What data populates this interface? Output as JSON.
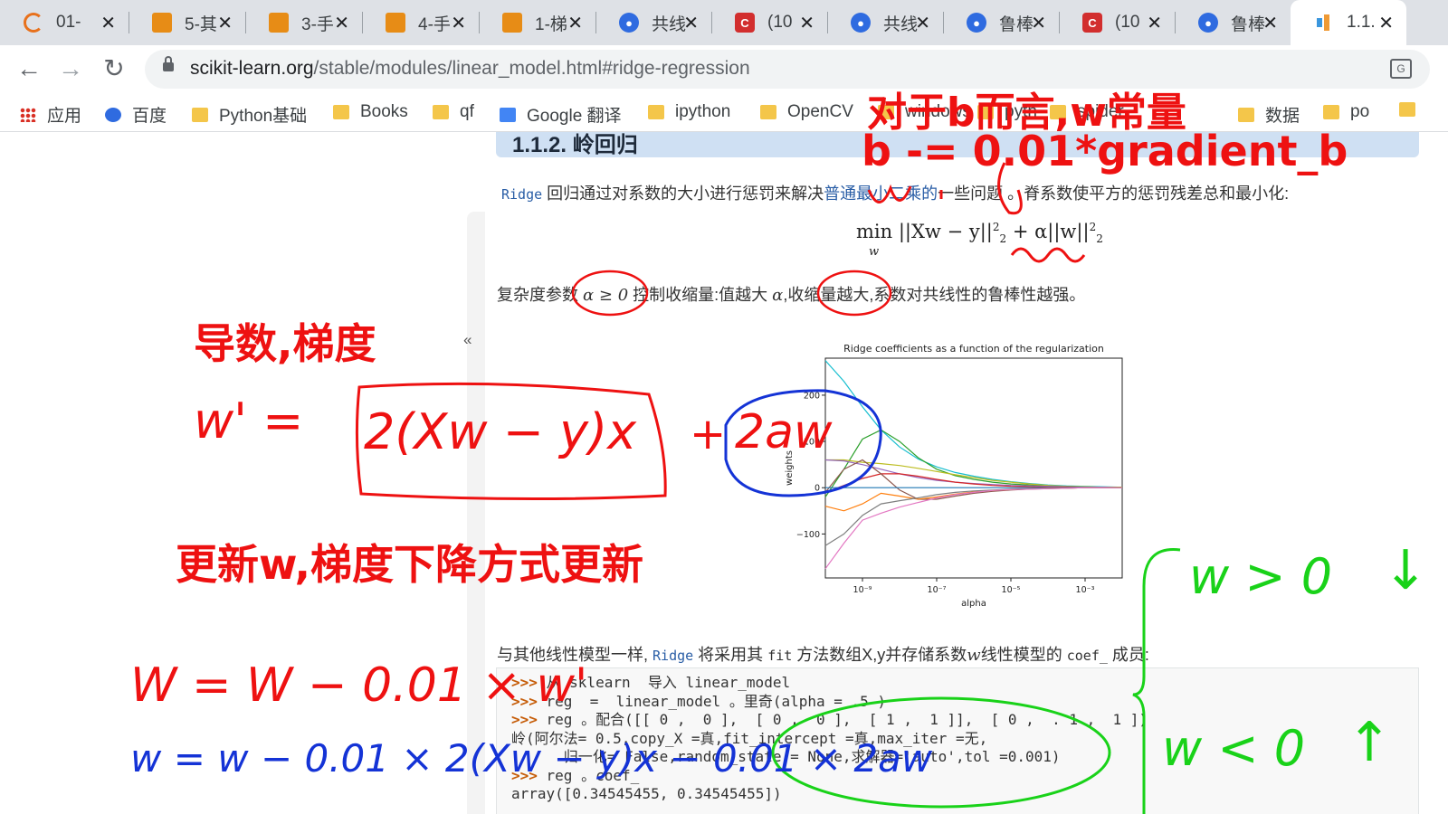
{
  "tabs": [
    {
      "title": "01-",
      "icon": "ring-icon"
    },
    {
      "title": "5-其",
      "icon": "book-icon"
    },
    {
      "title": "3-手",
      "icon": "book-icon"
    },
    {
      "title": "4-手",
      "icon": "book-icon"
    },
    {
      "title": "1-梯",
      "icon": "book-icon"
    },
    {
      "title": "共线",
      "icon": "baidu-paw-icon"
    },
    {
      "title": "(10",
      "icon": "csdn-c-icon"
    },
    {
      "title": "共线",
      "icon": "baidu-paw-icon"
    },
    {
      "title": "鲁棒",
      "icon": "baidu-paw-icon"
    },
    {
      "title": "(10",
      "icon": "csdn-c-icon"
    },
    {
      "title": "鲁棒",
      "icon": "baidu-paw-icon"
    },
    {
      "title": "1.1.",
      "icon": "sklearn-bars-icon"
    }
  ],
  "toolbar": {
    "url_host": "scikit-learn.org",
    "url_path": "/stable/modules/linear_model.html#ridge-regression"
  },
  "bookmarks": [
    {
      "label": "应用",
      "icon": "apps-grid-icon"
    },
    {
      "label": "百度",
      "icon": "baidu-paw-icon"
    },
    {
      "label": "Python基础",
      "icon": "folder-icon"
    },
    {
      "label": "Books",
      "icon": "folder-icon"
    },
    {
      "label": "qf",
      "icon": "folder-icon"
    },
    {
      "label": "Google 翻译",
      "icon": "google-translate-icon"
    },
    {
      "label": "ipython",
      "icon": "folder-icon"
    },
    {
      "label": "OpenCV",
      "icon": "folder-icon"
    },
    {
      "label": "windows",
      "icon": "folder-icon"
    },
    {
      "label": "pyth",
      "icon": "folder-icon"
    },
    {
      "label": "spider",
      "icon": "folder-icon"
    },
    {
      "label": "数据",
      "icon": "folder-icon"
    },
    {
      "label": "po",
      "icon": "folder-icon"
    }
  ],
  "doc": {
    "heading_fragment": "1.1.2. 岭回归",
    "ridge_code": "Ridge",
    "intro_before_link": " 回归通过对系数的大小进行惩罚来解决",
    "intro_link": "普通最小二乘的",
    "intro_after_link": "一些问题 。脊系数使平方的惩罚残差总和最小化:",
    "formula_main": "min ||Xw − y||",
    "formula_sub_w": "w",
    "formula_plus": " + α||w||",
    "formula_exp": "2",
    "formula_idx": "2",
    "complexity_text_1": "复杂度参数 ",
    "complexity_alpha": "α ≥ 0",
    "complexity_text_2": " 控制收缩量:值越大 ",
    "complexity_alpha2": "α",
    "complexity_text_3": ",收缩量越大,系数对共线性的鲁棒性越强。",
    "collapse_glyph": "«",
    "like_before_1": "与其他线性模型一样, ",
    "like_code_1": "Ridge",
    "like_before_2": " 将采用其 ",
    "like_code_2": "fit",
    "like_before_3": " 方法数组X,y并存储系数",
    "like_w": "w",
    "like_before_4": "线性模型的 ",
    "like_code_3": "coef_",
    "like_after": " 成员:",
    "code_lines": [
      {
        "prompt": ">>> ",
        "text": "从 sklearn  导入 linear_model"
      },
      {
        "prompt": ">>> ",
        "text": "reg  =  linear_model 。里奇(alpha = .5 )"
      },
      {
        "prompt": ">>> ",
        "text": "reg 。配合([[ 0 ,  0 ],  [ 0 ,  0 ],  [ 1 ,  1 ]],  [ 0 ,  . 1 ,  1 ])"
      },
      {
        "prompt": "",
        "text": "岭(阿尔法= 0.5,copy_X =真,fit_intercept =真,max_iter =无,"
      },
      {
        "prompt": "",
        "text": "      归一化= False,random_state = None,求解器='auto',tol =0.001)"
      },
      {
        "prompt": ">>> ",
        "text": "reg 。coef_"
      },
      {
        "prompt": "",
        "text": "array([0.34545455, 0.34545455])"
      }
    ]
  },
  "chart_data": {
    "type": "line",
    "title": "Ridge coefficients as a function of the regularization",
    "xlabel": "alpha",
    "ylabel": "weights",
    "xscale": "log",
    "x_ticks": [
      "10⁻⁹",
      "10⁻⁷",
      "10⁻⁵",
      "10⁻³"
    ],
    "x_tick_exponents": [
      -9,
      -7,
      -5,
      -3
    ],
    "y_ticks": [
      200,
      100,
      0,
      -100
    ],
    "xlim_exp": [
      -10,
      -2
    ],
    "ylim": [
      -195,
      280
    ],
    "grid": false,
    "x": [
      -10,
      -9.5,
      -9,
      -8.5,
      -8,
      -7.5,
      -7,
      -6.5,
      -6,
      -5.5,
      -5,
      -4.5,
      -4,
      -3.5,
      -3,
      -2.5,
      -2
    ],
    "series": [
      {
        "color": "#17becf",
        "values": [
          275,
          230,
          175,
          125,
          88,
          62,
          45,
          33,
          25,
          18,
          13,
          9,
          6,
          4,
          3,
          2,
          1
        ]
      },
      {
        "color": "#2ca02c",
        "values": [
          -20,
          40,
          105,
          125,
          100,
          65,
          40,
          26,
          18,
          12,
          8,
          6,
          4,
          3,
          2,
          1,
          1
        ]
      },
      {
        "color": "#bcbd22",
        "values": [
          60,
          60,
          55,
          52,
          48,
          42,
          35,
          28,
          22,
          16,
          12,
          8,
          5,
          3,
          2,
          1,
          1
        ]
      },
      {
        "color": "#9467bd",
        "values": [
          60,
          58,
          50,
          40,
          30,
          22,
          16,
          12,
          9,
          7,
          5,
          4,
          3,
          2,
          1,
          1,
          0
        ]
      },
      {
        "color": "#d62728",
        "values": [
          -10,
          5,
          20,
          30,
          30,
          25,
          18,
          12,
          8,
          5,
          3,
          2,
          1,
          1,
          0,
          0,
          0
        ]
      },
      {
        "color": "#8c564b",
        "values": [
          -10,
          40,
          60,
          30,
          -5,
          -25,
          -25,
          -18,
          -12,
          -8,
          -5,
          -3,
          -2,
          -1,
          0,
          0,
          0
        ]
      },
      {
        "color": "#1f77b4",
        "values": [
          0,
          0,
          0,
          0,
          0,
          0,
          0,
          0,
          0,
          0,
          0,
          0,
          0,
          0,
          0,
          0,
          0
        ]
      },
      {
        "color": "#ff7f0e",
        "values": [
          -40,
          -50,
          -35,
          -12,
          -18,
          -25,
          -20,
          -14,
          -9,
          -6,
          -4,
          -2,
          -1,
          -1,
          0,
          0,
          0
        ]
      },
      {
        "color": "#7f7f7f",
        "values": [
          -125,
          -100,
          -60,
          -35,
          -28,
          -22,
          -15,
          -10,
          -7,
          -5,
          -3,
          -2,
          -1,
          -1,
          0,
          0,
          0
        ]
      },
      {
        "color": "#e377c2",
        "values": [
          -175,
          -120,
          -70,
          -55,
          -42,
          -32,
          -22,
          -15,
          -10,
          -6,
          -4,
          -3,
          -2,
          -1,
          0,
          0,
          0
        ]
      }
    ]
  },
  "annotations": {
    "red_top_1": "对于b而言,w常量",
    "red_top_2": "b -= 0.01*gradient_b",
    "red_deriv": "导数,梯度",
    "red_update": "更新w,梯度下降方式更新",
    "hand_wprime": "w' =",
    "hand_grad1": "2(Xw − y)x",
    "hand_plus": "+",
    "hand_grad2": "2aw",
    "hand_w_update": "W = W − 0.01 × w'",
    "hand_blue": "w = w − 0.01 × 2(Xw − y)x − 0.01 × 2aw",
    "hand_green_1": "w > 0",
    "hand_green_2": "w < 0",
    "hand_arrow_down": "↓",
    "hand_arrow_up": "↑",
    "colors": {
      "red": "#ee1111",
      "blue": "#1433d6",
      "green": "#19d219"
    }
  }
}
